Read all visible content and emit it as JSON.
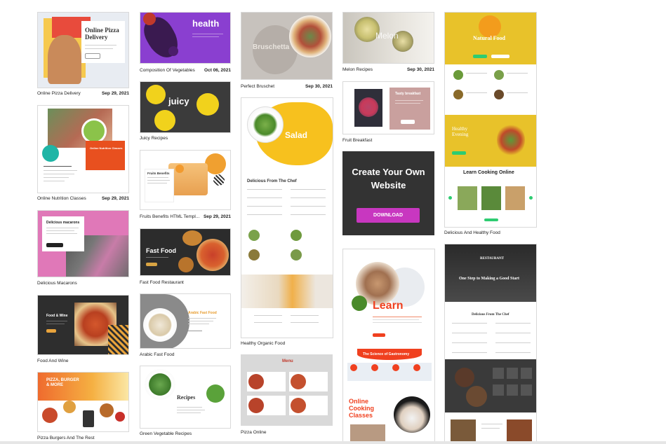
{
  "cards": [
    {
      "id": "online-pizza",
      "caption": "Online Pizza Delivery",
      "date": "Sep 29, 2021",
      "thumb_title": "Online Pizza Delivery"
    },
    {
      "id": "online-nutrition",
      "caption": "Online Nutrition Classes",
      "date": "Sep 29, 2021",
      "thumb_title": "Online Nutrition Classes"
    },
    {
      "id": "delicious-macarons",
      "caption": "Delicious Macarons",
      "date": "",
      "thumb_title": "Delicious macarons"
    },
    {
      "id": "food-and-wine",
      "caption": "Food And Wine",
      "date": "",
      "thumb_title": "Food & Wine"
    },
    {
      "id": "pizza-burgers",
      "caption": "Pizza Burgers And The Rest",
      "date": "",
      "thumb_title": "PIZZA, BURGER & MORE"
    },
    {
      "id": "composition-vegetables",
      "caption": "Composition Of Vegetables",
      "date": "Oct 06, 2021",
      "thumb_title": "health"
    },
    {
      "id": "juicy-recipes",
      "caption": "Juicy Recipes",
      "date": "",
      "thumb_title": "juicy"
    },
    {
      "id": "fruits-benefits",
      "caption": "Fruits Benefits HTML Templ...",
      "date": "Sep 29, 2021",
      "thumb_title": "Fruits Benefits"
    },
    {
      "id": "fast-food-restaurant",
      "caption": "Fast Food Restaurant",
      "date": "",
      "thumb_title": "Fast Food"
    },
    {
      "id": "arabic-fast-food",
      "caption": "Arabic Fast Food",
      "date": "",
      "thumb_title": "Arabic Fast Food"
    },
    {
      "id": "green-vegetable",
      "caption": "Green Vegetable Recipes",
      "date": "",
      "thumb_title": "Recipes"
    },
    {
      "id": "perfect-bruschetta",
      "caption": "Perfect Bruschet",
      "date": "Sep 30, 2021",
      "thumb_title": "Bruschetta"
    },
    {
      "id": "healthy-organic",
      "caption": "Healthy Organic Food",
      "date": "",
      "thumb_title": "Salad",
      "thumb_heading": "Delicious From The Chef"
    },
    {
      "id": "pizza-online",
      "caption": "Pizza Online",
      "date": "",
      "thumb_title": "Menu"
    },
    {
      "id": "melon-recipes",
      "caption": "Melon Recipes",
      "date": "Sep 30, 2021",
      "thumb_title": "Melon"
    },
    {
      "id": "fruit-breakfast",
      "caption": "Fruit Breakfast",
      "date": "",
      "thumb_title": "Tasty breakfast"
    },
    {
      "id": "learn-cooking",
      "caption": "",
      "date": "",
      "thumb_title": "Learn",
      "thumb_sub": "The Science of Gastronomy",
      "thumb_bottom": "Online Cooking Classes"
    },
    {
      "id": "delicious-healthy",
      "caption": "Delicious And Healthy Food",
      "date": "",
      "thumb_title": "Natural Food",
      "thumb_sub": "Healthy Evening",
      "thumb_heading": "Learn Cooking Online"
    },
    {
      "id": "restaurant",
      "caption": "",
      "date": "",
      "thumb_title": "RESTAURANT",
      "thumb_sub": "One Step to Making a Good Start",
      "thumb_heading": "Delicious From The Chef"
    }
  ],
  "promo": {
    "title": "Create Your Own Website",
    "button": "DOWNLOAD"
  },
  "colors": {
    "promo_bg": "#333333",
    "promo_button": "#c837c0",
    "caption_text": "#222222"
  }
}
